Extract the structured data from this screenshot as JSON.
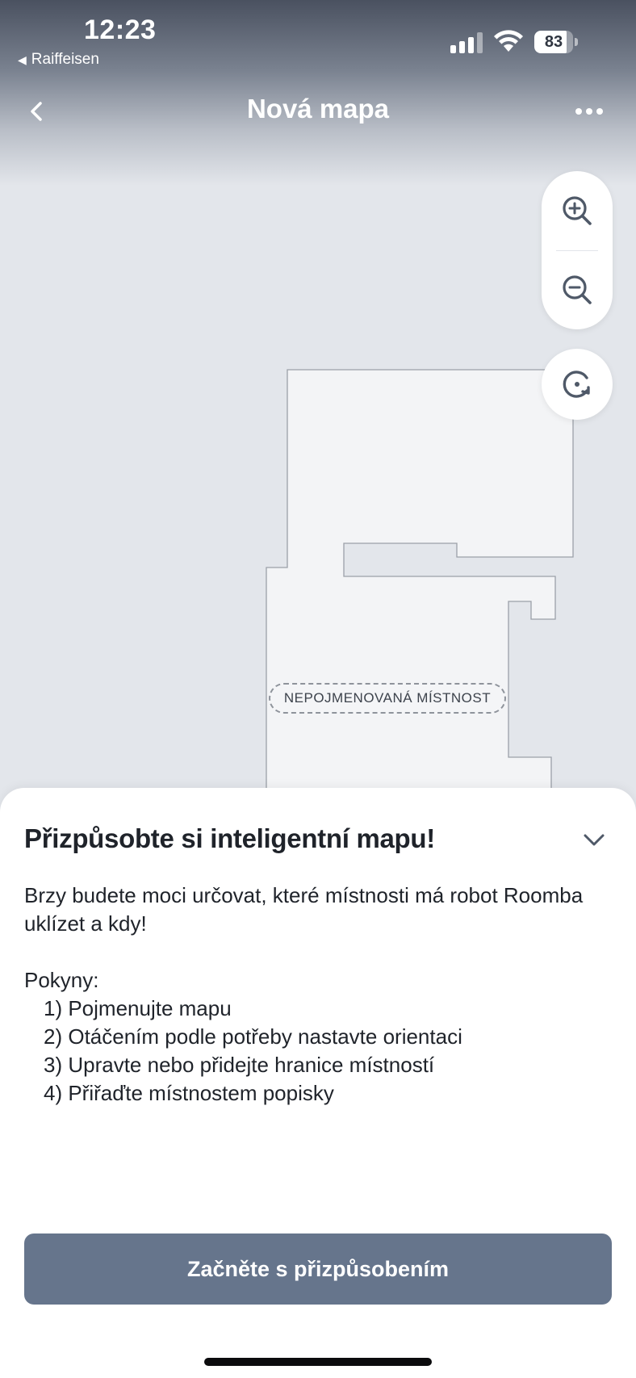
{
  "status_bar": {
    "time": "12:23",
    "back_app": "Raiffeisen",
    "battery_percent": "83",
    "battery_level": 0.83
  },
  "nav": {
    "title": "Nová mapa",
    "back_icon": "chevron-left-icon",
    "more_icon": "ellipsis-icon"
  },
  "map": {
    "room_label": "NEPOJMENOVANÁ MÍSTNOST",
    "controls": {
      "zoom_in_icon": "zoom-in-icon",
      "zoom_out_icon": "zoom-out-icon",
      "rotate_icon": "rotate-icon"
    }
  },
  "sheet": {
    "title": "Přizpůsobte si inteligentní mapu!",
    "intro": "Brzy budete moci určovat, které místnosti má robot Roomba uklízet a kdy!",
    "steps_heading": "Pokyny:",
    "steps": [
      "1) Pojmenujte mapu",
      "2) Otáčením podle potřeby nastavte orientaci",
      "3) Upravte nebo přidejte hranice místností",
      "4) Přiřaďte místnostem popisky"
    ],
    "cta_label": "Začněte s přizpůsobením"
  },
  "colors": {
    "map_background": "#e3e6eb",
    "room_fill": "#f3f4f6",
    "cta_background": "#66758c"
  }
}
